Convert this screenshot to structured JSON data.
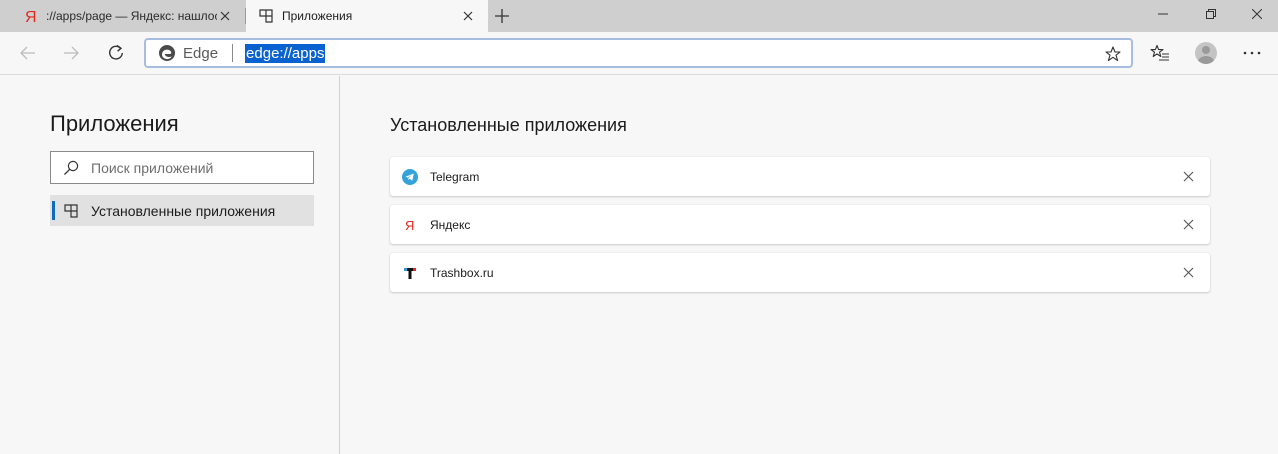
{
  "tabs": [
    {
      "title": "://apps/page — Яндекс: нашлос",
      "favicon": "yandex-icon",
      "active": false
    },
    {
      "title": "Приложения",
      "favicon": "apps-icon",
      "active": true
    }
  ],
  "toolbar": {
    "browser_label": "Edge",
    "url": "edge://apps"
  },
  "sidebar": {
    "title": "Приложения",
    "search_placeholder": "Поиск приложений",
    "items": [
      {
        "label": "Установленные приложения",
        "icon": "apps-icon",
        "selected": true
      }
    ]
  },
  "main": {
    "title": "Установленные приложения",
    "apps": [
      {
        "name": "Telegram",
        "icon": "telegram-icon"
      },
      {
        "name": "Яндекс",
        "icon": "yandex-icon"
      },
      {
        "name": "Trashbox.ru",
        "icon": "trashbox-icon"
      }
    ]
  },
  "colors": {
    "accent": "#0f6cbd",
    "url_highlight": "#0a62d0",
    "yandex_red": "#e0291d",
    "telegram_blue": "#35a3db"
  }
}
